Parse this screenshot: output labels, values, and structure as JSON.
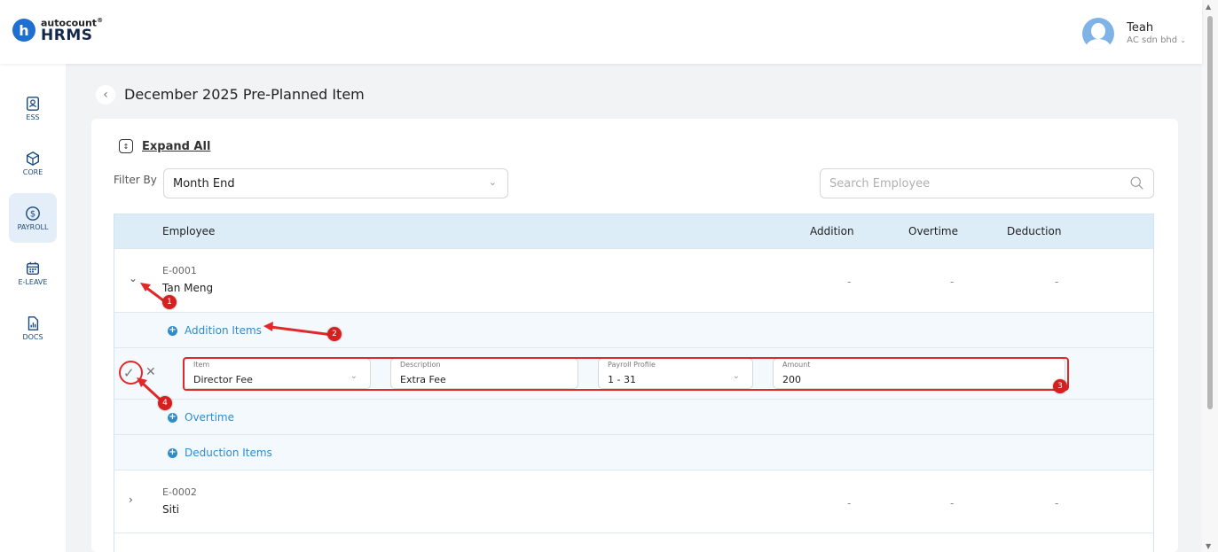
{
  "header": {
    "logo_small": "autocount",
    "logo_mark": "®",
    "logo_big": "HRMS",
    "user_name": "Teah",
    "user_company": "AC sdn bhd"
  },
  "sidebar": {
    "items": [
      {
        "label": "ESS",
        "icon": "profile-card-icon"
      },
      {
        "label": "CORE",
        "icon": "cube-icon"
      },
      {
        "label": "PAYROLL",
        "icon": "dollar-circle-icon"
      },
      {
        "label": "E-LEAVE",
        "icon": "calendar-icon"
      },
      {
        "label": "DOCS",
        "icon": "document-chart-icon"
      }
    ],
    "active": "PAYROLL"
  },
  "page": {
    "title": "December 2025 Pre-Planned Item"
  },
  "toolbar": {
    "expand_all": "Expand All",
    "filter_label": "Filter By",
    "filter_value": "Month End",
    "search_placeholder": "Search Employee"
  },
  "table": {
    "columns": [
      "Employee",
      "Addition",
      "Overtime",
      "Deduction"
    ],
    "rows": [
      {
        "code": "E-0001",
        "name": "Tan Meng",
        "addition": "-",
        "overtime": "-",
        "deduction": "-",
        "expanded": true
      },
      {
        "code": "E-0002",
        "name": "Siti",
        "addition": "-",
        "overtime": "-",
        "deduction": "-",
        "expanded": false
      }
    ],
    "sections": {
      "addition": "Addition Items",
      "overtime": "Overtime",
      "deduction": "Deduction Items"
    },
    "edit_form": {
      "item_label": "Item",
      "item_value": "Director Fee",
      "description_label": "Description",
      "description_value": "Extra Fee",
      "profile_label": "Payroll Profile",
      "profile_value": "1 - 31",
      "amount_label": "Amount",
      "amount_value": "200"
    }
  },
  "annotations": {
    "badges": [
      "1",
      "2",
      "3",
      "4"
    ],
    "color": "#e02a2a"
  },
  "colors": {
    "accent": "#2f8ccc",
    "header_row": "#dcedf8",
    "brand": "#1f6fd1"
  }
}
